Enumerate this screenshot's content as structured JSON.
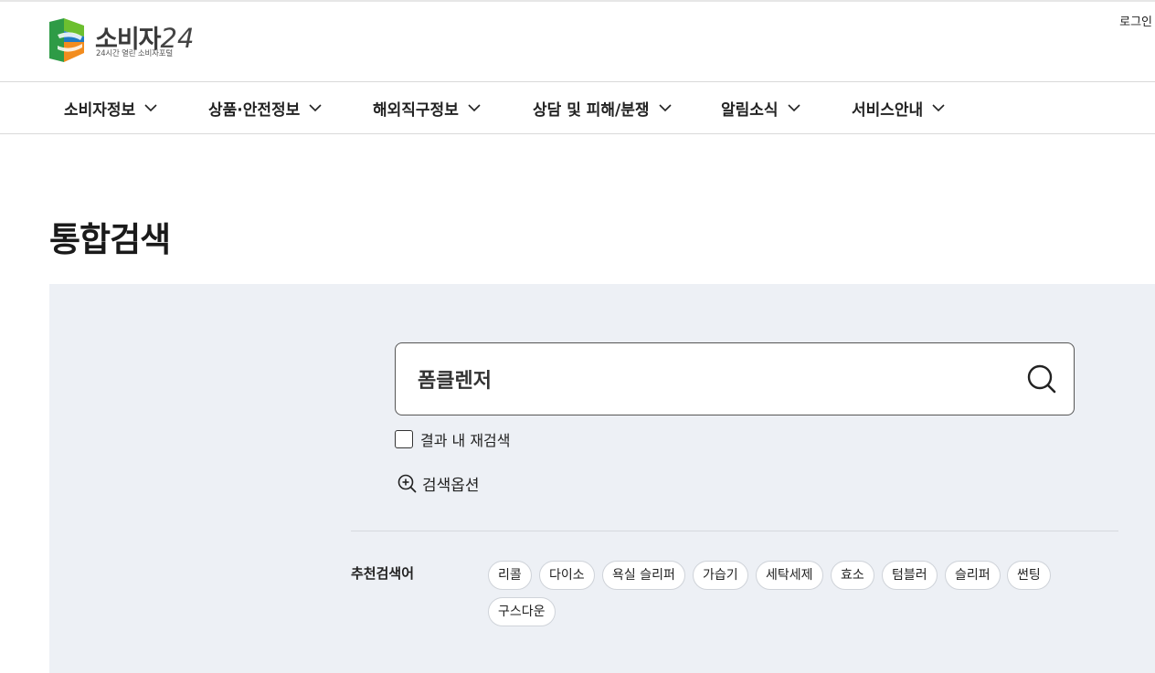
{
  "header": {
    "logo": {
      "name": "소비자",
      "number": "24",
      "tagline": "24시간 열린 소비자포털",
      "colors": [
        "#2e9b46",
        "#1f7ac4",
        "#f28c1e",
        "#6cbf2f"
      ]
    },
    "login_label": "로그인"
  },
  "gnb": {
    "items": [
      {
        "label": "소비자정보"
      },
      {
        "label": "상품·안전정보"
      },
      {
        "label": "해외직구정보"
      },
      {
        "label": "상담 및 피해/분쟁"
      },
      {
        "label": "알림소식"
      },
      {
        "label": "서비스안내"
      }
    ]
  },
  "page": {
    "title": "통합검색"
  },
  "search": {
    "value": "폼클렌저",
    "recheck_label": "결과 내 재검색",
    "options_label": "검색옵션",
    "icon": "search-icon"
  },
  "recommend": {
    "title": "추천검색어",
    "keywords": [
      "리콜",
      "다이소",
      "욕실 슬리퍼",
      "가습기",
      "세탁세제",
      "효소",
      "텀블러",
      "슬리퍼",
      "썬팅",
      "구스다운"
    ]
  },
  "colors": {
    "panel_bg": "#edf0f5",
    "border": "#d9d9d9"
  }
}
